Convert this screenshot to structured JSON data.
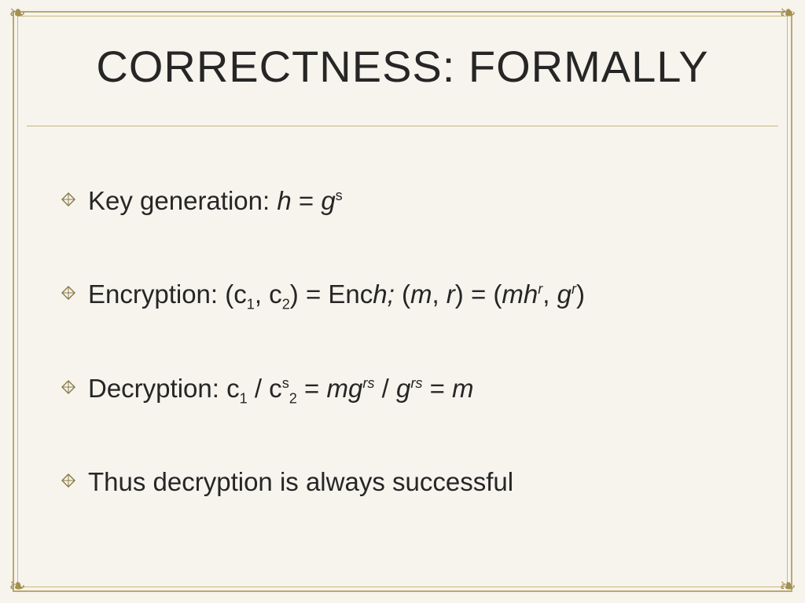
{
  "title": "CORRECTNESS: FORMALLY",
  "items": {
    "keygen": {
      "lead": "Key generation: ",
      "h": "h",
      "eq": " = ",
      "g": "g",
      "s": "s"
    },
    "enc": {
      "lead": "Encryption: (c",
      "sub1": "1",
      "mid1": ",  c",
      "sub2": "2",
      "mid2": ")  =  Enc",
      "hsemi": "h; ",
      "paren_open": "(",
      "m": "m",
      "comma_r": ", ",
      "r": "r",
      "close_eq": ") = (",
      "mh": "mh",
      "sup_r1": "r",
      "comma2": ", ",
      "g": "g",
      "sup_r2": "r",
      "close": ")"
    },
    "dec": {
      "lead": "Decryption: c",
      "sub1": "1",
      "slash": "  /  c",
      "sup_s": "s",
      "sub2": "2",
      "eq1": " = ",
      "mg": "mg",
      "sup_rs1": "rs",
      "over": " / ",
      "g": "g",
      "sup_rs2": "rs",
      "eq2": " = ",
      "m": "m"
    },
    "thus": "Thus decryption is always successful"
  }
}
